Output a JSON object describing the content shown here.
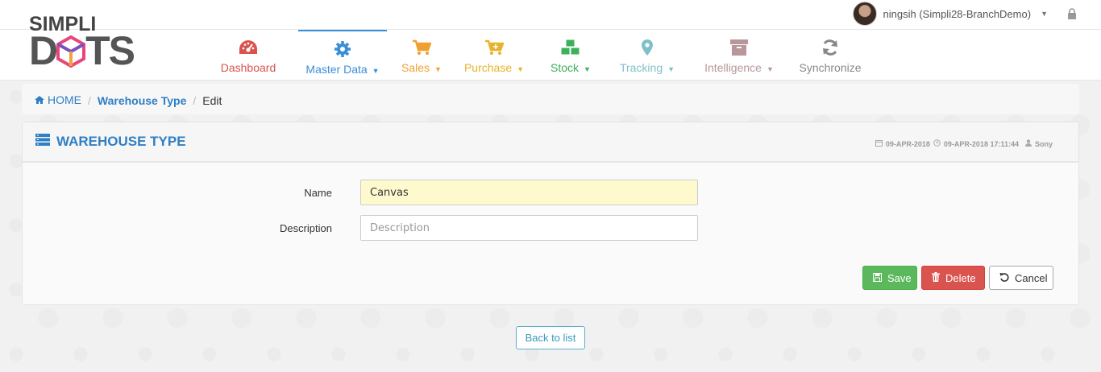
{
  "user": {
    "name": "ningsih (Simpli28-BranchDemo)"
  },
  "logo": {
    "line1": "SIMPLI",
    "line2_left": "D",
    "line2_right": "TS"
  },
  "nav": {
    "items": [
      {
        "label": "Dashboard",
        "color": "#d9534f",
        "icon": "dashboard-gauge-icon",
        "dropdown": false
      },
      {
        "label": "Master Data",
        "color": "#3a8fd8",
        "icon": "gear-icon",
        "dropdown": true
      },
      {
        "label": "Sales",
        "color": "#f0a030",
        "icon": "cart-icon",
        "dropdown": true
      },
      {
        "label": "Purchase",
        "color": "#e8b22a",
        "icon": "cart-plus-icon",
        "dropdown": true
      },
      {
        "label": "Stock",
        "color": "#3cb05b",
        "icon": "cubes-icon",
        "dropdown": true
      },
      {
        "label": "Tracking",
        "color": "#7fc0c8",
        "icon": "map-marker-icon",
        "dropdown": true
      },
      {
        "label": "Intelligence",
        "color": "#b8969a",
        "icon": "archive-icon",
        "dropdown": true
      },
      {
        "label": "Synchronize",
        "color": "#888888",
        "icon": "refresh-icon",
        "dropdown": false
      }
    ]
  },
  "breadcrumb": {
    "home": "HOME",
    "section": "Warehouse Type",
    "current": "Edit"
  },
  "panel": {
    "title": "WAREHOUSE TYPE",
    "created": "09-APR-2018",
    "modified": "09-APR-2018 17:11:44",
    "author": "Sony"
  },
  "form": {
    "name_label": "Name",
    "name_value": "Canvas",
    "description_label": "Description",
    "description_placeholder": "Description"
  },
  "buttons": {
    "save": "Save",
    "delete": "Delete",
    "cancel": "Cancel",
    "back": "Back to list"
  }
}
